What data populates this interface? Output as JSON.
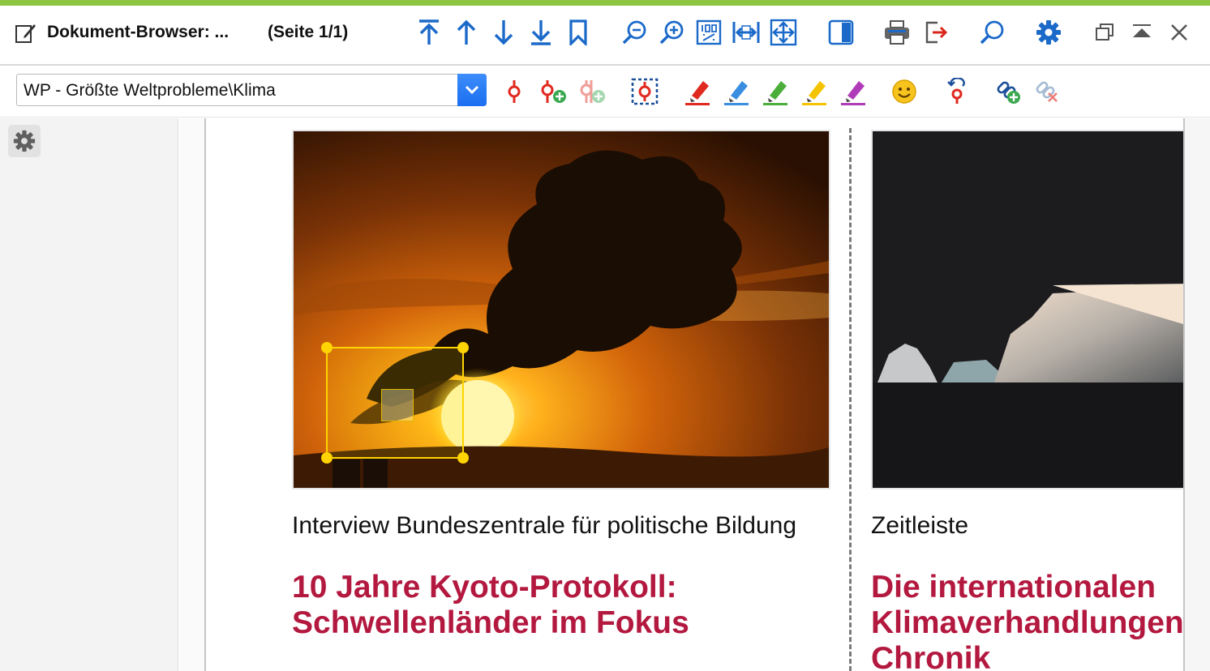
{
  "window": {
    "title": "Dokument-Browser: ...",
    "page_indicator": "(Seite 1/1)"
  },
  "toolbar_icons": [
    "first-page-icon",
    "prev-page-icon",
    "next-page-icon",
    "last-page-icon",
    "bookmark-icon",
    "zoom-out-icon",
    "zoom-in-icon",
    "zoom-100-icon",
    "fit-width-icon",
    "fit-page-icon",
    "panel-toggle-icon",
    "print-icon",
    "export-icon",
    "search-icon",
    "settings-icon",
    "restore-window-icon",
    "collapse-icon",
    "close-icon"
  ],
  "code_selector": {
    "value": "WP - Größte Weltprobleme\\Klima"
  },
  "coding_tools": [
    "code-icon",
    "new-code-icon",
    "in-vivo-code-icon",
    "area-select-icon",
    "highlighter-red-icon",
    "highlighter-blue-icon",
    "highlighter-green-icon",
    "highlighter-yellow-icon",
    "highlighter-purple-icon",
    "emoticode-icon",
    "undo-coding-icon",
    "add-link-icon",
    "remove-link-icon"
  ],
  "colors": {
    "accent_bar": "#8cc53f",
    "headline": "#b3183f",
    "selection": "#ffd400",
    "toolbar_icon": "#1b6ac9"
  },
  "articles": [
    {
      "caption": "Interview Bundeszentrale für politische Bildung",
      "headline_line1": "10 Jahre Kyoto-Protokoll:",
      "headline_line2": "Schwellenländer im Fokus"
    },
    {
      "caption": "Zeitleiste",
      "headline_line1": "Die internationalen",
      "headline_line2": "Klimaverhandlungen",
      "headline_line3": "Chronik"
    }
  ]
}
